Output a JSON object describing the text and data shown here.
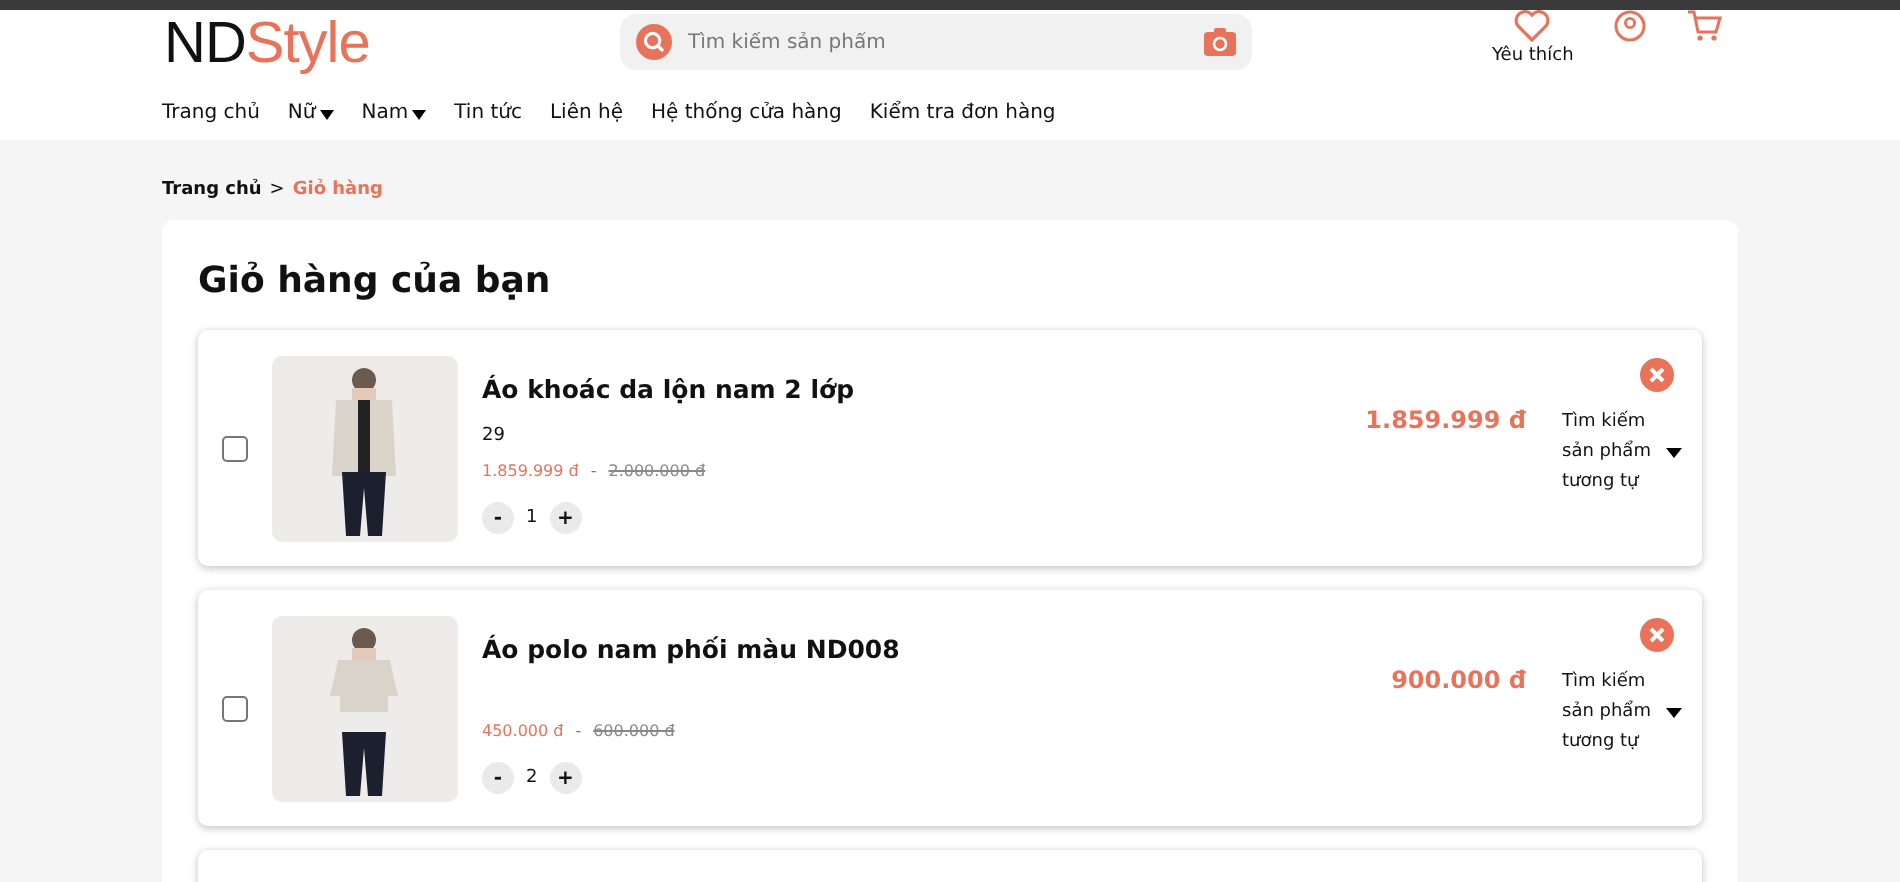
{
  "logo": {
    "part_1": "ND",
    "part_2": "Style"
  },
  "search": {
    "placeholder": "Tìm kiếm sản phẩm"
  },
  "header_actions": [
    {
      "kind": "heart",
      "label": "Yêu thích"
    },
    {
      "kind": "user"
    },
    {
      "kind": "cart"
    }
  ],
  "nav": [
    {
      "label": "Trang chủ",
      "dropdown": false
    },
    {
      "label": "Nữ",
      "dropdown": true
    },
    {
      "label": "Nam",
      "dropdown": true
    },
    {
      "label": "Tin tức",
      "dropdown": false
    },
    {
      "label": "Liên hệ",
      "dropdown": false
    },
    {
      "label": "Hệ thống cửa hàng",
      "dropdown": false
    },
    {
      "label": "Kiểm tra đơn hàng",
      "dropdown": false
    }
  ],
  "breadcrumb": [
    {
      "label": "Trang chủ",
      "selected": false
    },
    {
      "label": "Giỏ hàng",
      "selected": true
    }
  ],
  "breadcrumb_separator": ">",
  "cart": {
    "title": "Giỏ hàng của bạn",
    "items": [
      {
        "name": "Áo khoác da lộn nam 2 lớp",
        "size": "29",
        "price": "1.859.999 đ",
        "price_separator": "-",
        "old_price": "2.000.000 đ",
        "quantity": "1",
        "total": "1.859.999 đ",
        "checked": false,
        "similar": "Tìm kiếm sản phẩm tương tự"
      },
      {
        "name": "Áo polo nam phối màu ND008",
        "price": "450.000 đ",
        "price_separator": "-",
        "old_price": "600.000 đ",
        "quantity": "2",
        "total": "900.000 đ",
        "checked": false,
        "similar": "Tìm kiếm sản phẩm tương tự"
      }
    ],
    "quantity_minus": "-",
    "quantity_plus": "+"
  }
}
